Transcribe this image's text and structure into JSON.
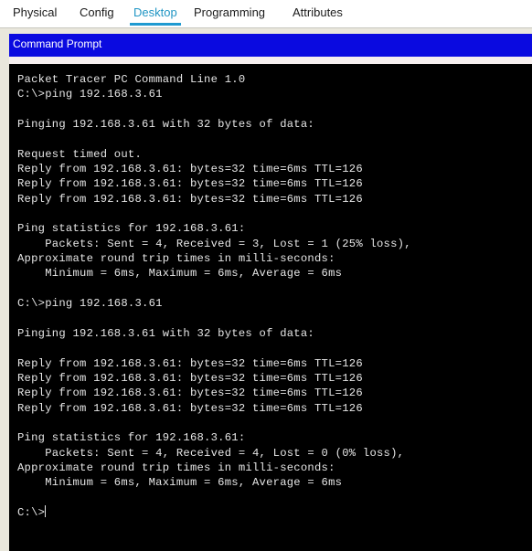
{
  "tabs": [
    {
      "id": "physical",
      "label": "Physical",
      "active": false
    },
    {
      "id": "config",
      "label": "Config",
      "active": false
    },
    {
      "id": "desktop",
      "label": "Desktop",
      "active": true
    },
    {
      "id": "programming",
      "label": "Programming",
      "active": false
    },
    {
      "id": "attributes",
      "label": "Attributes",
      "active": false
    }
  ],
  "window": {
    "title": "Command Prompt",
    "titlebar_color": "#0a0ae0",
    "titlebar_text_color": "#ffffff"
  },
  "terminal": {
    "background": "#000000",
    "foreground": "#e6e6e6",
    "prompt": "C:\\>",
    "cursor_visible": true,
    "lines": [
      "Packet Tracer PC Command Line 1.0",
      "C:\\>ping 192.168.3.61",
      "",
      "Pinging 192.168.3.61 with 32 bytes of data:",
      "",
      "Request timed out.",
      "Reply from 192.168.3.61: bytes=32 time=6ms TTL=126",
      "Reply from 192.168.3.61: bytes=32 time=6ms TTL=126",
      "Reply from 192.168.3.61: bytes=32 time=6ms TTL=126",
      "",
      "Ping statistics for 192.168.3.61:",
      "    Packets: Sent = 4, Received = 3, Lost = 1 (25% loss),",
      "Approximate round trip times in milli-seconds:",
      "    Minimum = 6ms, Maximum = 6ms, Average = 6ms",
      "",
      "C:\\>ping 192.168.3.61",
      "",
      "Pinging 192.168.3.61 with 32 bytes of data:",
      "",
      "Reply from 192.168.3.61: bytes=32 time=6ms TTL=126",
      "Reply from 192.168.3.61: bytes=32 time=6ms TTL=126",
      "Reply from 192.168.3.61: bytes=32 time=6ms TTL=126",
      "Reply from 192.168.3.61: bytes=32 time=6ms TTL=126",
      "",
      "Ping statistics for 192.168.3.61:",
      "    Packets: Sent = 4, Received = 4, Lost = 0 (0% loss),",
      "Approximate round trip times in milli-seconds:",
      "    Minimum = 6ms, Maximum = 6ms, Average = 6ms",
      "",
      "C:\\>"
    ]
  }
}
